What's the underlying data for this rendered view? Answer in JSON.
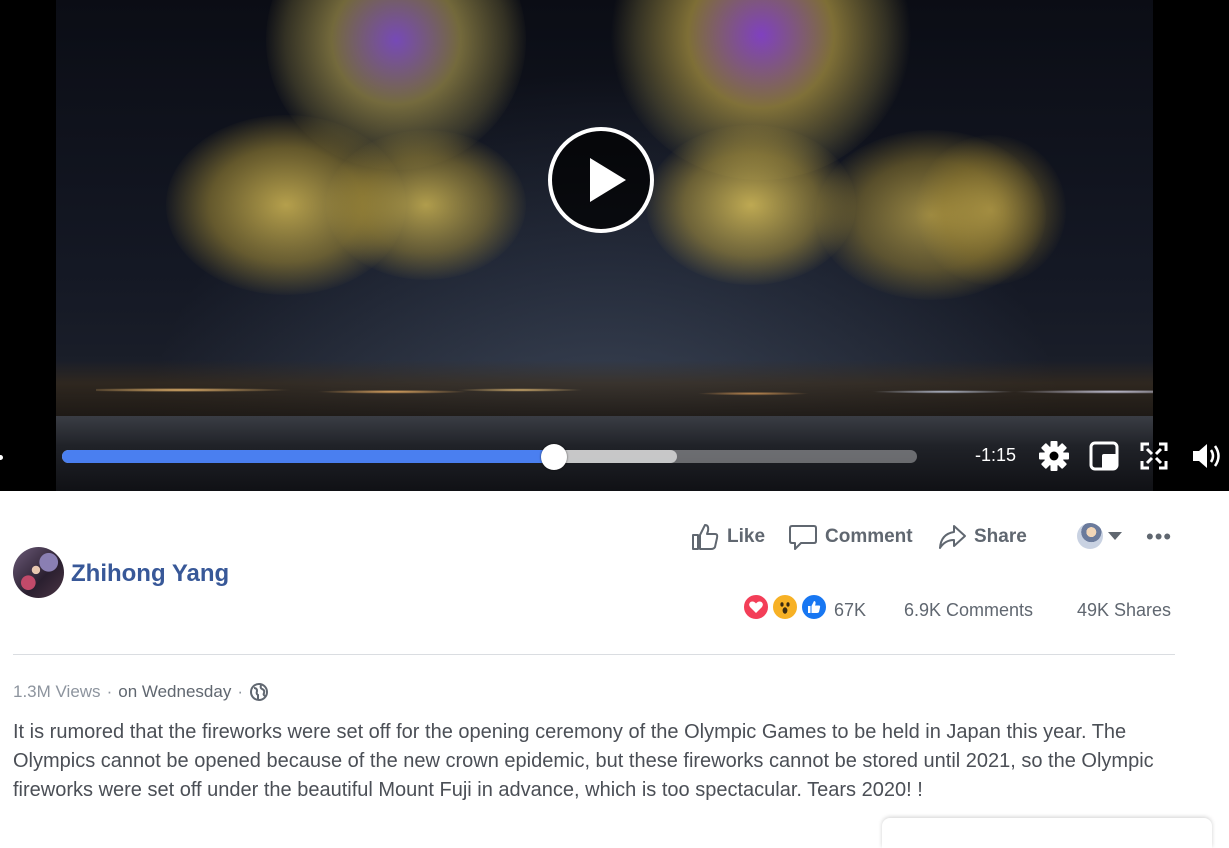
{
  "video": {
    "time_remaining": "-1:15",
    "progress_fraction": 0.576,
    "buffered_fraction": 0.719
  },
  "post_actions": {
    "like_label": "Like",
    "comment_label": "Comment",
    "share_label": "Share",
    "more_label": "•••"
  },
  "author": {
    "name": "Zhihong Yang"
  },
  "stats": {
    "reaction_count": "67K",
    "comments": "6.9K Comments",
    "shares": "49K Shares"
  },
  "meta": {
    "views": "1.3M Views",
    "separator": "·",
    "posted": "on Wednesday"
  },
  "post": {
    "text": "It is rumored that the fireworks were set off for the opening ceremony of the Olympic Games to be held in Japan this year. The Olympics cannot be opened because of the new crown epidemic, but these fireworks cannot be stored until 2021, so the Olympic fireworks were set off under the beautiful Mount Fuji in advance, which is too spectacular. Tears 2020! !"
  },
  "colors": {
    "link_blue": "#385898",
    "progress_blue": "#4a7ff0",
    "love_red": "#f33e58",
    "wow_yellow": "#f7b125",
    "like_blue": "#1877f2",
    "text_gray": "#606770"
  },
  "icons": {
    "controls": [
      "play-icon",
      "gear-icon",
      "miniplayer-icon",
      "fullscreen-icon",
      "volume-icon"
    ],
    "actions": [
      "thumbs-up-icon",
      "comment-icon",
      "share-arrow-icon",
      "caret-down-icon",
      "more-icon"
    ],
    "reactions": [
      "love-reaction-icon",
      "wow-reaction-icon",
      "like-reaction-icon"
    ],
    "privacy": "globe-icon"
  }
}
